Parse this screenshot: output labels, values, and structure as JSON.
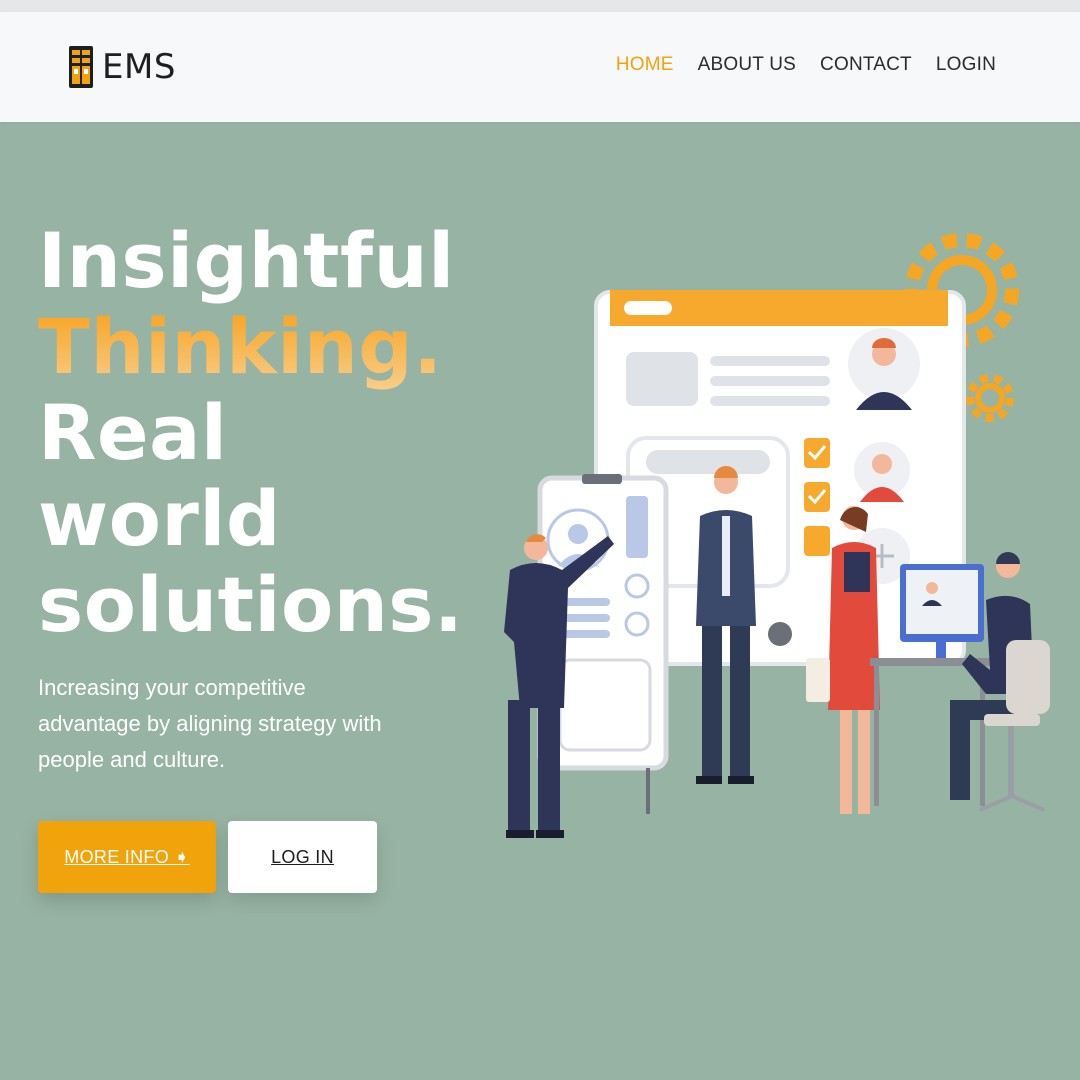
{
  "brand": {
    "name": "EMS",
    "icon": "ems-logo-icon"
  },
  "nav": [
    {
      "label": "HOME",
      "active": true
    },
    {
      "label": "ABOUT US",
      "active": false
    },
    {
      "label": "CONTACT",
      "active": false
    },
    {
      "label": "LOGIN",
      "active": false
    }
  ],
  "hero": {
    "line1": "Insightful",
    "line2": "Thinking.",
    "line3": "Real",
    "line4": "world",
    "line5": "solutions.",
    "subtitle": "Increasing your competitive advantage by aligning strategy with people and culture."
  },
  "buttons": {
    "more_info": "MORE INFO ➧",
    "log_in": "LOG IN"
  },
  "colors": {
    "accent": "#f0a30a",
    "background": "#97b3a4",
    "navbar": "#f7f8f9"
  },
  "illustration": "team-management-illustration"
}
